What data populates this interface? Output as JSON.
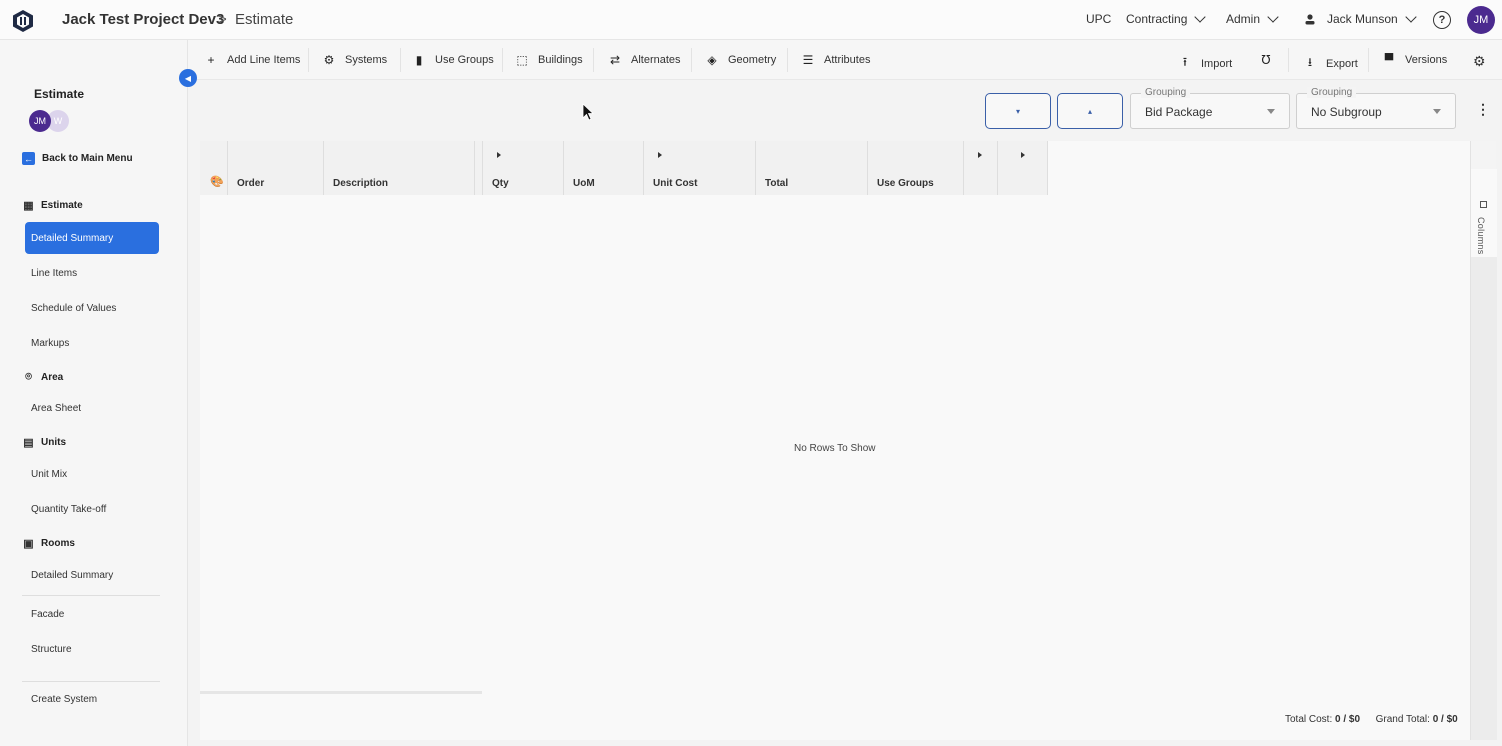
{
  "topbar": {
    "project_title": "Jack Test Project Dev3",
    "crumb_sep": ">",
    "page_title": "Estimate",
    "upc": "UPC",
    "contracting": "Contracting",
    "admin": "Admin",
    "user_name": "Jack Munson",
    "help_glyph": "?",
    "avatar_initials": "JM"
  },
  "toolbar": {
    "items": [
      {
        "label": "Add Line Items",
        "icon": "plus-icon",
        "glyph": "+"
      },
      {
        "label": "Systems",
        "icon": "gears-icon",
        "glyph": "⚙"
      },
      {
        "label": "Use Groups",
        "icon": "bar-chart-icon",
        "glyph": "▮"
      },
      {
        "label": "Buildings",
        "icon": "frame-icon",
        "glyph": "⬚"
      },
      {
        "label": "Alternates",
        "icon": "swap-icon",
        "glyph": "⇄"
      },
      {
        "label": "Geometry",
        "icon": "cube-icon",
        "glyph": "◈"
      },
      {
        "label": "Attributes",
        "icon": "list-icon",
        "glyph": "☰"
      }
    ],
    "import": "Import",
    "export": "Export",
    "versions": "Versions",
    "import_glyph": "⭱",
    "export_glyph": "⭳",
    "stethoscope_glyph": "℧",
    "versions_glyph": "▀",
    "settings_glyph": "⚙"
  },
  "sidebar": {
    "title": "Estimate",
    "avatar1": "JM",
    "avatar2": "W",
    "back": "Back to Main Menu",
    "collapse_glyph": "◀",
    "sections": {
      "estimate": "Estimate",
      "area": "Area",
      "units": "Units",
      "rooms": "Rooms"
    },
    "section_glyphs": {
      "estimate": "▦",
      "area": "⌾",
      "units": "▤",
      "rooms": "▣"
    },
    "items": {
      "detailed_summary": "Detailed Summary",
      "line_items": "Line Items",
      "schedule_of_values": "Schedule of Values",
      "markups": "Markups",
      "area_sheet": "Area Sheet",
      "unit_mix": "Unit Mix",
      "quantity_takeoff": "Quantity Take-off",
      "rooms_detailed_summary": "Detailed Summary",
      "facade": "Facade",
      "structure": "Structure",
      "create_system": "Create System"
    }
  },
  "controls": {
    "collapse_glyph": "▾",
    "expand_glyph": "▴",
    "grouping_label": "Grouping",
    "grouping_value": "Bid Package",
    "subgroup_label": "Grouping",
    "subgroup_value": "No Subgroup",
    "more_glyph": "⋮"
  },
  "grid": {
    "palette_glyph": "🎨",
    "columns": [
      "Order",
      "Description",
      "Qty",
      "UoM",
      "Unit Cost",
      "Total",
      "Use Groups"
    ],
    "empty_message": "No Rows To Show"
  },
  "footer": {
    "total_cost_label": "Total Cost:",
    "total_cost_value": "0 / $0",
    "grand_total_label": "Grand Total:",
    "grand_total_value": "0 / $0"
  },
  "side_panel": {
    "columns_label": "Columns"
  }
}
